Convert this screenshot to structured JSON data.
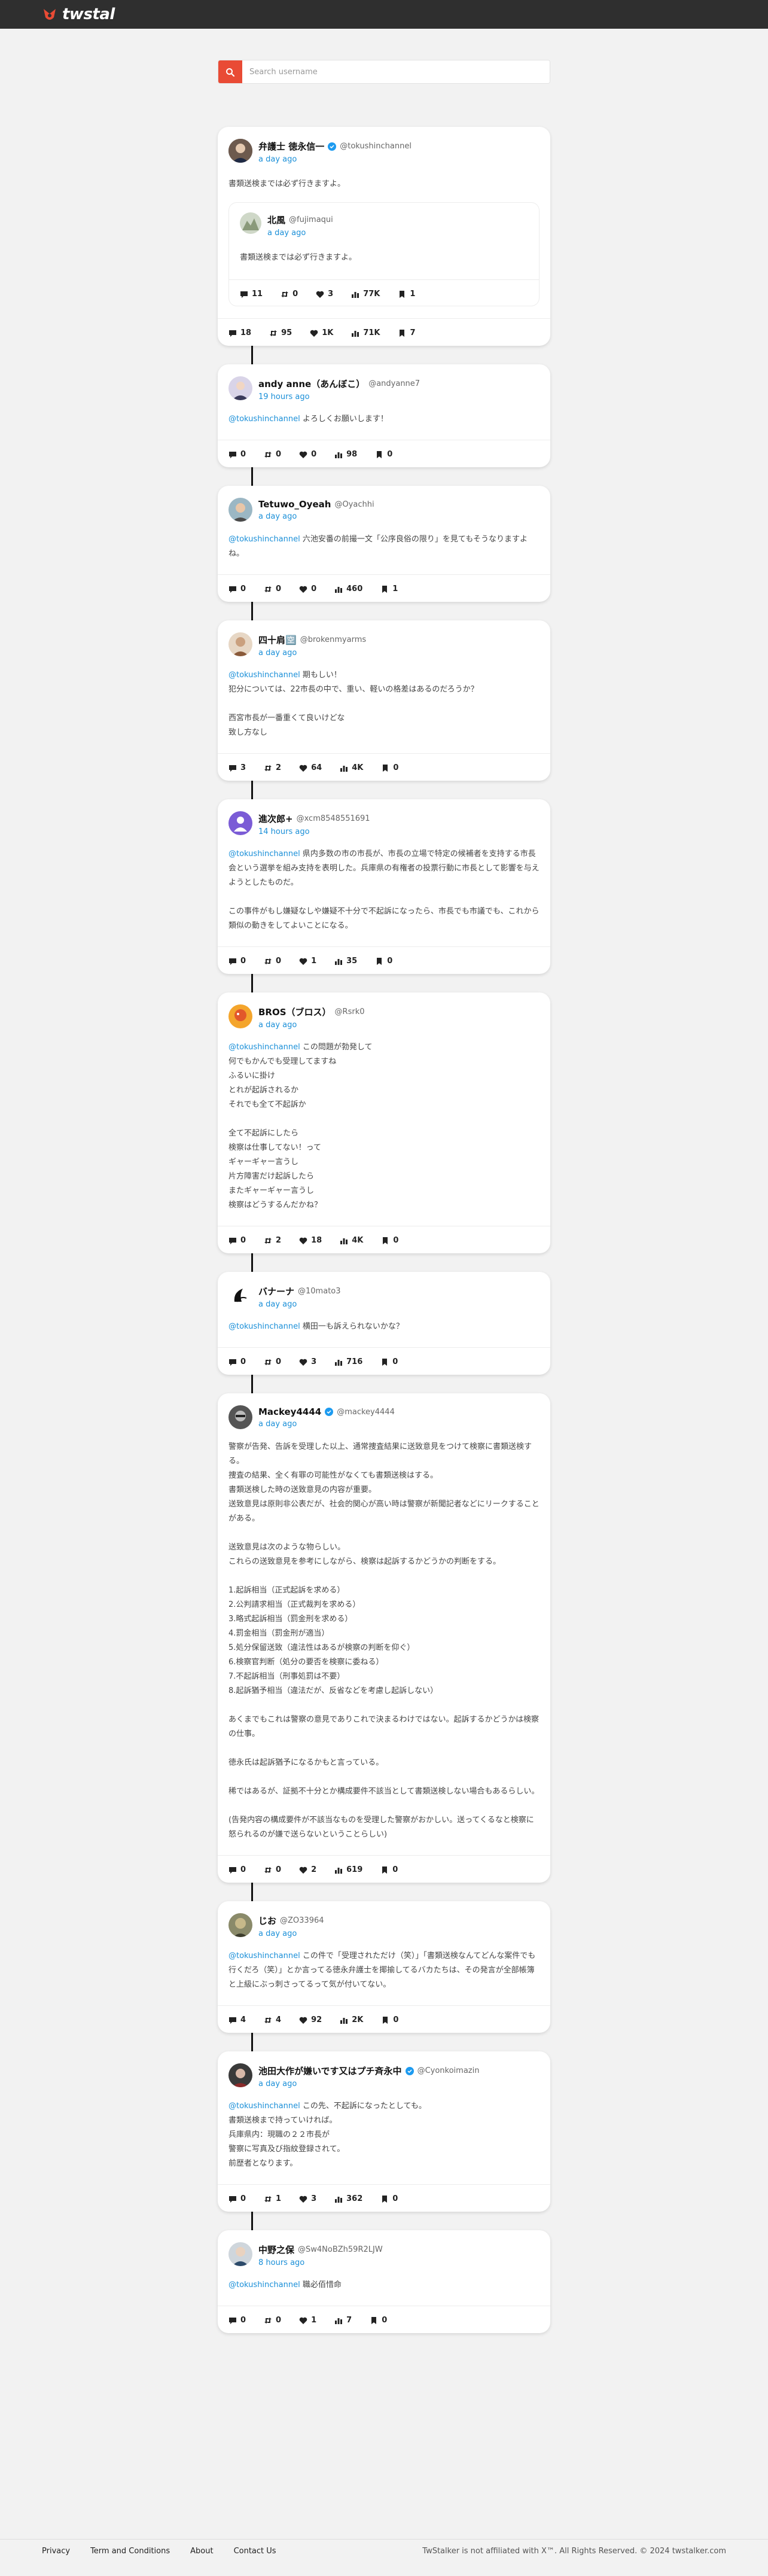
{
  "brand": {
    "name": "twstal",
    "accent": "#e94b35"
  },
  "search": {
    "placeholder": "Search username"
  },
  "main_post": {
    "name": "弁護士 徳永信一",
    "handle": "@tokushinchannel",
    "verified": true,
    "time": "a day ago",
    "text": "書類送検までは必ず行きますよ。",
    "quote": {
      "name": "北風",
      "handle": "@fujimaqui",
      "time": "a day ago",
      "text": "書類送検までは必ず行きますよ。",
      "stats": {
        "replies": "11",
        "retweets": "0",
        "likes": "3",
        "views": "77K",
        "bookmarks": "1"
      }
    },
    "stats": {
      "replies": "18",
      "retweets": "95",
      "likes": "1K",
      "views": "71K",
      "bookmarks": "7"
    }
  },
  "replies": [
    {
      "name": "andy anne（あんぼこ）",
      "handle": "@andyanne7",
      "time": "19 hours ago",
      "mention": "@tokushinchannel",
      "text": " よろしくお願いします！",
      "stats": {
        "replies": "0",
        "retweets": "0",
        "likes": "0",
        "views": "98",
        "bookmarks": "0"
      }
    },
    {
      "name": "Tetuwo_Oyeah",
      "handle": "@Oyachhi",
      "time": "a day ago",
      "mention": "@tokushinchannel",
      "text": " 六池安番の前撮一文「公序良俗の限り」を見てもそうなりますよね。",
      "stats": {
        "replies": "0",
        "retweets": "0",
        "likes": "0",
        "views": "460",
        "bookmarks": "1"
      }
    },
    {
      "name": "四十肩🈳",
      "handle": "@brokenmyarms",
      "time": "a day ago",
      "mention": "@tokushinchannel",
      "text": " 期もしい！\n犯分については、22市長の中で、重い、軽いの格差はあるのだろうか？\n\n西宮市長が一番重くて良いけどな\n致し方なし",
      "stats": {
        "replies": "3",
        "retweets": "2",
        "likes": "64",
        "views": "4K",
        "bookmarks": "0"
      }
    },
    {
      "name": "進次郎+",
      "handle": "@xcm8548551691",
      "time": "14 hours ago",
      "mention": "@tokushinchannel",
      "text": " 県内多数の市の市長が、市長の立場で特定の候補者を支持する市長会という選挙を組み支持を表明した。兵庫県の有権者の投票行動に市長として影響を与えようとしたものだ。\n\nこの事件がもし嫌疑なしや嫌疑不十分で不起訴になったら、市長でも市議でも、これから類似の動きをしてよいことになる。",
      "stats": {
        "replies": "0",
        "retweets": "0",
        "likes": "1",
        "views": "35",
        "bookmarks": "0"
      }
    },
    {
      "name": "BROS（ブロス）",
      "handle": "@Rsrk0",
      "time": "a day ago",
      "mention": "@tokushinchannel",
      "text": " この問題が勃発して\n何でもかんでも受理してますね\nふるいに掛け\nとれが起訴されるか\nそれでも全て不起訴か\n\n全て不起訴にしたら\n検察は仕事してない！って\nギャーギャー言うし\n片方障害だけ起訴したら\nまたギャーギャー言うし\n検察はどうするんだかね？",
      "stats": {
        "replies": "0",
        "retweets": "2",
        "likes": "18",
        "views": "4K",
        "bookmarks": "0"
      }
    },
    {
      "name": "バナーナ",
      "handle": "@10mato3",
      "time": "a day ago",
      "mention": "@tokushinchannel",
      "text": " 横田一も訴えられないかな？",
      "stats": {
        "replies": "0",
        "retweets": "0",
        "likes": "3",
        "views": "716",
        "bookmarks": "0"
      }
    },
    {
      "name": "Mackey4444",
      "handle": "@mackey4444",
      "time": "a day ago",
      "verified": true,
      "mention": "",
      "text": "警察が告発、告訴を受理した以上、通常捜査結果に送致意見をつけて検察に書類送検する。\n捜査の結果、全く有罪の可能性がなくても書類送検はする。\n書類送検した時の送致意見の内容が重要。\n送致意見は原則非公表だが、社会的関心が高い時は警察が新聞記者などにリークすることがある。\n\n送致意見は次のような物らしい。\nこれらの送致意見を参考にしながら、検察は起訴するかどうかの判断をする。\n\n1.起訴相当（正式起訴を求める）\n2.公判請求相当（正式裁判を求める）\n3.略式起訴相当（罰金刑を求める）\n4.罰金相当（罰金刑が適当）\n5.処分保留送致（違法性はあるが検察の判断を仰ぐ）\n6.検察官判断（処分の要否を検察に委ねる）\n7.不起訴相当（刑事処罰は不要）\n8.起訴猶予相当（違法だが、反省などを考慮し起訴しない）\n\nあくまでもこれは警察の意見でありこれで決まるわけではない。起訴するかどうかは検察の仕事。\n\n徳永氏は起訴猶予になるかもと言っている。\n\n稀ではあるが、証拠不十分とか構成要件不該当として書類送検しない場合もあるらしい。\n\n(告発内容の構成要件が不該当なものを受理した警察がおかしい。送ってくるなと検察に怒られるのが嫌で送らないということらしい)",
      "stats": {
        "replies": "0",
        "retweets": "0",
        "likes": "2",
        "views": "619",
        "bookmarks": "0"
      }
    },
    {
      "name": "じお",
      "handle": "@ZO33964",
      "time": "a day ago",
      "mention": "@tokushinchannel",
      "text": " この件で「受理されただけ（笑）」「書類送検なんてどんな案件でも行くだろ（笑）」とか言ってる徳永弁護士を揶揄してるバカたちは、その発言が全部帳簿と上級にぶっ刺さってるって気が付いてない。",
      "stats": {
        "replies": "4",
        "retweets": "4",
        "likes": "92",
        "views": "2K",
        "bookmarks": "0"
      }
    },
    {
      "name": "池田大作が嫌いです又はプチ斉永中",
      "handle": "@Cyonkoimazin",
      "time": "a day ago",
      "verified": true,
      "mention": "@tokushinchannel",
      "text": " この先、不起訴になったとしても。\n書類送検まで持っていければ。\n兵庫県内：現職の２２市長が\n警察に写真及び指紋登録されて。\n前歴者となります。",
      "stats": {
        "replies": "0",
        "retweets": "1",
        "likes": "3",
        "views": "362",
        "bookmarks": "0"
      }
    },
    {
      "name": "中野之保",
      "handle": "@Sw4NoBZh59R2LJW",
      "time": "8 hours ago",
      "mention": "@tokushinchannel",
      "text": " 職必佰惜命",
      "stats": {
        "replies": "0",
        "retweets": "0",
        "likes": "1",
        "views": "7",
        "bookmarks": "0"
      }
    }
  ],
  "footer": {
    "links": [
      "Privacy",
      "Term and Conditions",
      "About",
      "Contact Us"
    ],
    "right": "TwStalker is not affiliated with X™. All Rights Reserved. © 2024 twstalker.com"
  }
}
